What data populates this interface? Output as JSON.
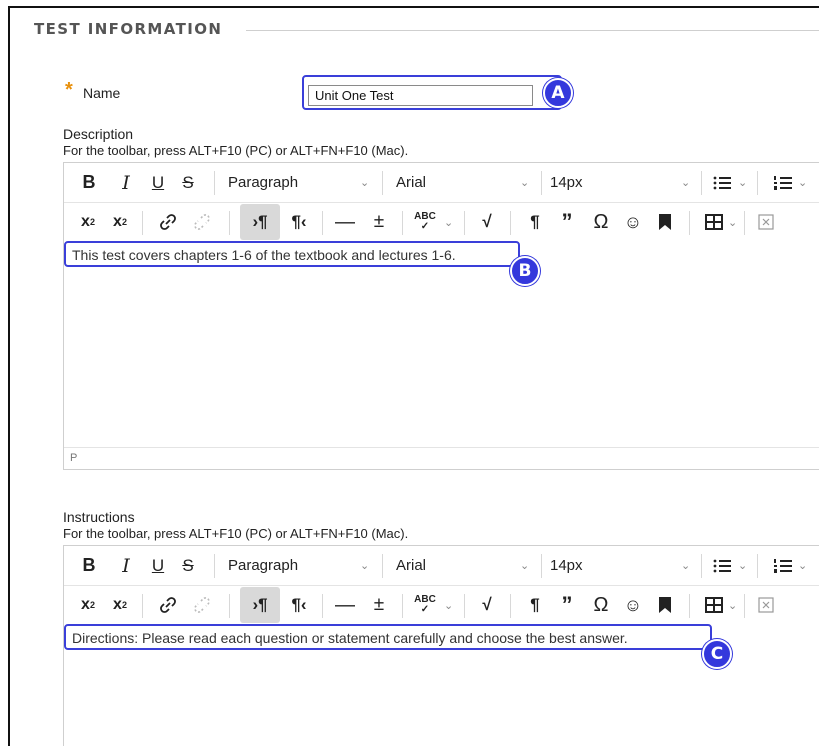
{
  "section": {
    "title": "TEST INFORMATION"
  },
  "name_field": {
    "required_marker": "*",
    "label": "Name",
    "value": "Unit One Test",
    "callout": "A"
  },
  "description": {
    "label": "Description",
    "hint": "For the toolbar, press ALT+F10 (PC) or ALT+FN+F10 (Mac).",
    "content": "This test covers chapters 1-6 of the textbook and lectures 1-6.",
    "callout": "B",
    "status_path": "P"
  },
  "instructions": {
    "label": "Instructions",
    "hint": "For the toolbar, press ALT+F10 (PC) or ALT+FN+F10 (Mac).",
    "content": "Directions: Please read each question or statement carefully and choose the best answer.",
    "callout": "C"
  },
  "toolbar": {
    "bold": "B",
    "italic": "I",
    "underline": "U",
    "strike": "S",
    "block_format": "Paragraph",
    "font_family": "Arial",
    "font_size": "14px"
  },
  "colors": {
    "callout": "#3438dc",
    "required": "#e8900c"
  }
}
